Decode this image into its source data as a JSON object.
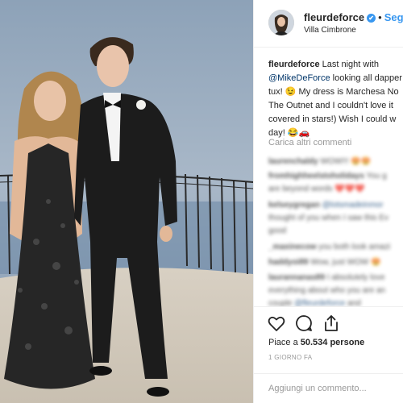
{
  "post": {
    "username": "fleurdeforce",
    "verified_mark": "✔",
    "separator": "•",
    "follow_label": "Segui",
    "location": "Villa Cimbrone"
  },
  "caption": {
    "username": "fleurdeforce",
    "line1": "Last night with",
    "mention": "@MikeDeForce",
    "line2": " looking all dapper",
    "line3": "tux! 😉 My dress is Marchesa No",
    "line4": "The Outnet and I couldn't love it",
    "line5": "covered in stars!) Wish I could w",
    "line6": "day! 😂🚗"
  },
  "load_more": "Carica altri commenti",
  "comments": [
    {
      "user": "laurenchaldy",
      "text": "WOW!!! 😍😍"
    },
    {
      "user": "fromhighheelstoholidays",
      "text": "You g"
    },
    {
      "user": "",
      "text": "are beyond words ❤️❤️❤️"
    },
    {
      "user": "kelseygregan",
      "text": "",
      "mention": "@lotsmadeinmor"
    },
    {
      "user": "",
      "text": "thought of you when I saw this Ev"
    },
    {
      "user": "",
      "text": "good"
    },
    {
      "user": "_maxinecow",
      "text": "you both look amazi"
    },
    {
      "user": "haddyoi89",
      "text": "Wow, just WOW 😍"
    },
    {
      "user": "laurannanas89",
      "text": "I absolutely love"
    },
    {
      "user": "",
      "text": "everything about who you are an"
    },
    {
      "user": "",
      "text": "couple ",
      "mention": "@fleurdeforce",
      "tail": " and"
    }
  ],
  "actions": {
    "like_icon": "heart-icon",
    "comment_icon": "comment-icon",
    "share_icon": "share-icon",
    "likes_prefix": "Piace a ",
    "likes_count": "50.534",
    "likes_suffix": " persone",
    "time": "1 GIORNO FA",
    "add_comment_placeholder": "Aggiungi un commento..."
  },
  "colors": {
    "accent": "#3897f0",
    "mention": "#003569",
    "muted": "#999999"
  }
}
